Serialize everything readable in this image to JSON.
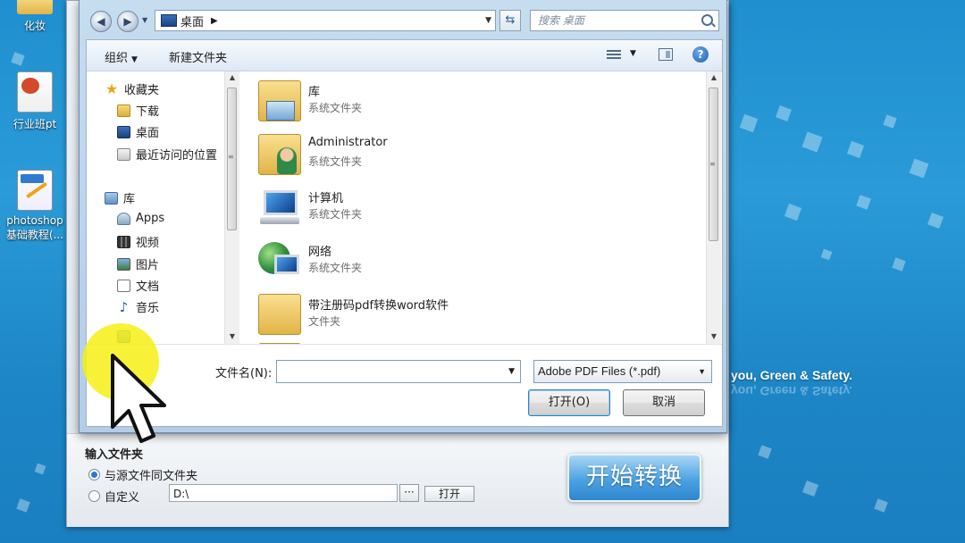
{
  "desktop": {
    "icons": [
      {
        "label": "化妆",
        "type": "folder"
      },
      {
        "label": "行业班pt",
        "type": "ppt"
      },
      {
        "label": "photoshop基础教程(...",
        "type": "pdf"
      }
    ],
    "slogan": "you, Green & Safety."
  },
  "dialog": {
    "address": {
      "location": "桌面"
    },
    "search_placeholder": "搜索 桌面",
    "toolbar": {
      "organize": "组织",
      "new_folder": "新建文件夹"
    },
    "nav_pane": {
      "favorites_header": "收藏夹",
      "favorites": [
        {
          "label": "下载",
          "icon": "download-folder-icon"
        },
        {
          "label": "桌面",
          "icon": "desktop-icon"
        },
        {
          "label": "最近访问的位置",
          "icon": "recent-places-icon"
        }
      ],
      "libraries_header": "库",
      "libraries": [
        {
          "label": "Apps",
          "icon": "apps-icon"
        },
        {
          "label": "视频",
          "icon": "video-icon"
        },
        {
          "label": "图片",
          "icon": "pictures-icon"
        },
        {
          "label": "文档",
          "icon": "documents-icon"
        },
        {
          "label": "音乐",
          "icon": "music-icon"
        }
      ]
    },
    "files": [
      {
        "name": "库",
        "type": "系统文件夹",
        "icon": "library-folder-icon"
      },
      {
        "name": "Administrator",
        "type": "系统文件夹",
        "icon": "user-folder-icon"
      },
      {
        "name": "计算机",
        "type": "系统文件夹",
        "icon": "computer-icon"
      },
      {
        "name": "网络",
        "type": "系统文件夹",
        "icon": "network-icon"
      },
      {
        "name": "带注册码pdf转换word软件",
        "type": "文件夹",
        "icon": "folder-icon"
      }
    ],
    "filename_label": "文件名(N):",
    "filename_value": "",
    "filetype_value": "Adobe PDF Files (*.pdf)",
    "open_button": "打开(O)",
    "cancel_button": "取消"
  },
  "app": {
    "output_folder_title": "输入文件夹",
    "radio_same": "与源文件同文件夹",
    "radio_custom": "自定义",
    "custom_path": "D:\\",
    "browse_button": "···",
    "open_button": "打开",
    "start_button": "开始转换"
  },
  "colors": {
    "desktop_bg": "#2a9bd8",
    "highlight": "#f6f014",
    "start_button": "#4ba2e2"
  }
}
